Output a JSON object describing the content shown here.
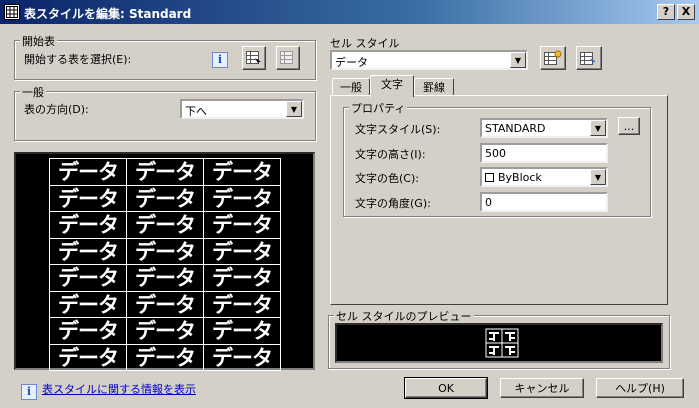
{
  "window": {
    "title": "表スタイルを編集: Standard",
    "help_button": "?",
    "close_button": "X"
  },
  "starting_table": {
    "legend": "開始表",
    "select_label": "開始する表を選択(E):"
  },
  "general": {
    "legend": "一般",
    "direction_label": "表の方向(D):",
    "direction_value": "下へ"
  },
  "preview_text": "データ",
  "cell_style": {
    "legend": "セル スタイル",
    "selected": "データ",
    "tabs": [
      "一般",
      "文字",
      "罫線"
    ],
    "active_tab": 1
  },
  "properties": {
    "legend": "プロパティ",
    "text_style_label": "文字スタイル(S):",
    "text_style_value": "STANDARD",
    "browse_button": "...",
    "text_height_label": "文字の高さ(I):",
    "text_height_value": "500",
    "text_color_label": "文字の色(C):",
    "text_color_value": "ByBlock",
    "text_angle_label": "文字の角度(G):",
    "text_angle_value": "0"
  },
  "cell_preview": {
    "legend": "セル スタイルのプレビュー"
  },
  "footer": {
    "info_link": "表スタイルに関する情報を表示",
    "ok_button": "OK",
    "cancel_button": "キャンセル",
    "help_button": "ヘルプ(H)"
  },
  "icons": {
    "info": "i",
    "title_icon": "table-style-icon",
    "dropdown_arrow": "▼"
  }
}
